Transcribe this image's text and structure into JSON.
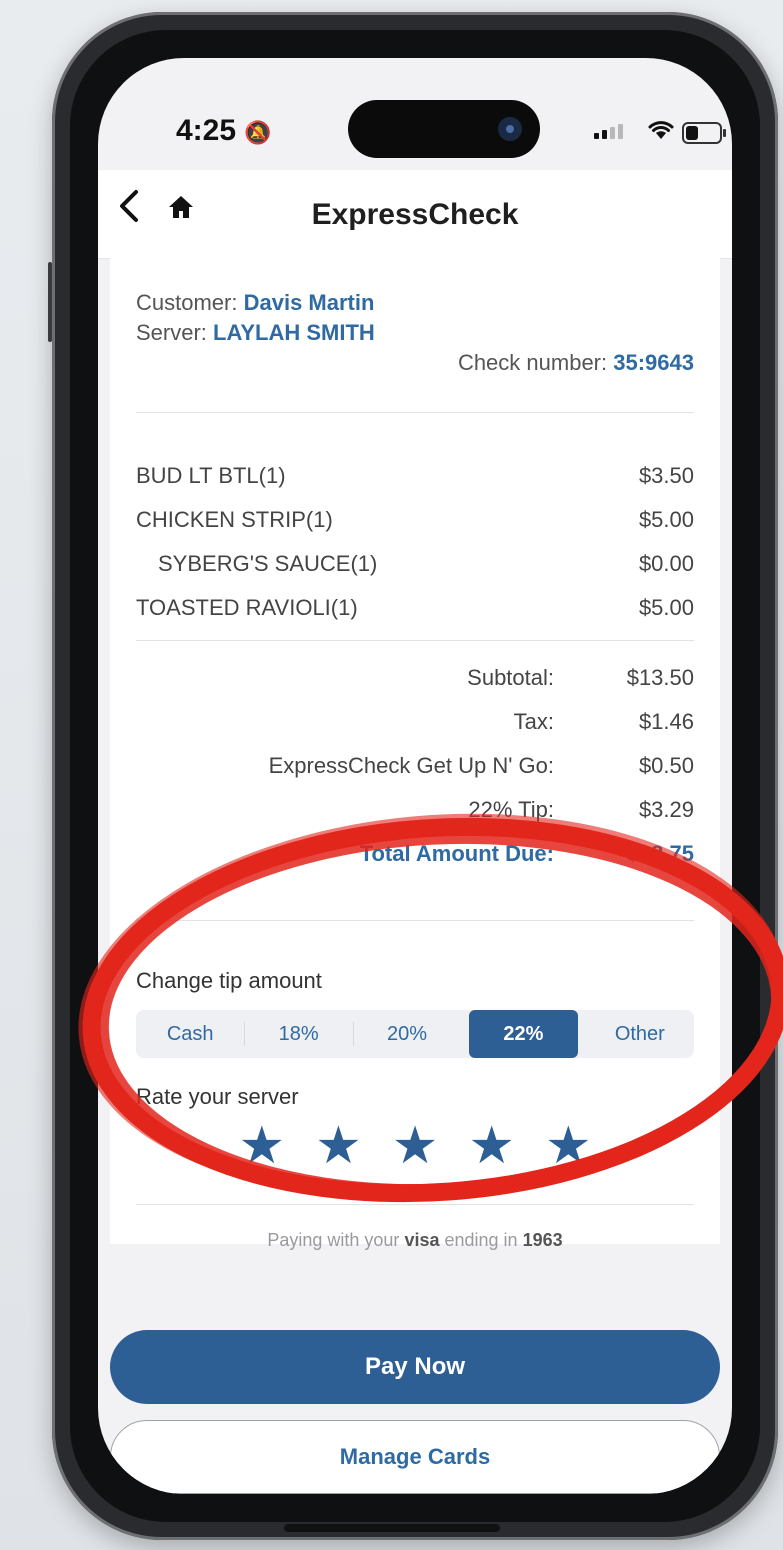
{
  "status": {
    "time": "4:25"
  },
  "header": {
    "title": "ExpressCheck"
  },
  "check": {
    "customer_label": "Customer:",
    "customer_name": "Davis Martin",
    "server_label": "Server:",
    "server_name": "LAYLAH SMITH",
    "check_label": "Check number:",
    "check_number": "35:9643"
  },
  "items": [
    {
      "name": "BUD LT BTL(1)",
      "price": "$3.50"
    },
    {
      "name": "CHICKEN STRIP(1)",
      "price": "$5.00"
    },
    {
      "name": "SYBERG'S SAUCE(1)",
      "price": "$0.00"
    },
    {
      "name": "TOASTED RAVIOLI(1)",
      "price": "$5.00"
    }
  ],
  "totals": {
    "subtotal_label": "Subtotal:",
    "subtotal": "$13.50",
    "tax_label": "Tax:",
    "tax": "$1.46",
    "fee_label": "ExpressCheck Get Up N' Go:",
    "fee": "$0.50",
    "tip_label": "22% Tip:",
    "tip": "$3.29",
    "total_label": "Total Amount Due:",
    "total": "$18.75"
  },
  "tip": {
    "label": "Change tip amount",
    "options": [
      "Cash",
      "18%",
      "20%",
      "22%",
      "Other"
    ],
    "selected": "22%"
  },
  "rating": {
    "label": "Rate your server",
    "stars": 5
  },
  "payment": {
    "prefix": "Paying with your",
    "brand": "visa",
    "middle": "ending in",
    "last4": "1963"
  },
  "buttons": {
    "pay": "Pay Now",
    "manage": "Manage Cards"
  },
  "colors": {
    "accent": "#2d5e94",
    "annotation": "#e3261c"
  }
}
